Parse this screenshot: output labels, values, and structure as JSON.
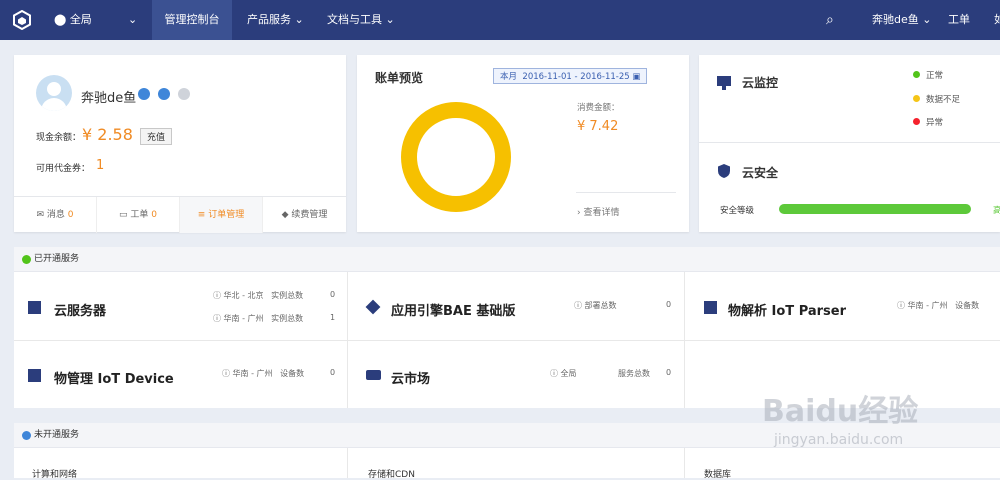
{
  "topbar": {
    "region": "全局",
    "nav": [
      "管理控制台",
      "产品服务",
      "文档与工具"
    ],
    "user": "奔驰de鱼",
    "ticket": "工单",
    "more": "如"
  },
  "account": {
    "name": "奔驰de鱼",
    "cash_label": "现金余额：",
    "cash_value": "¥ 2.58",
    "recharge": "充值",
    "voucher_label": "可用代金券：",
    "voucher_value": "1",
    "tabs": [
      {
        "label": "消息",
        "count": "0"
      },
      {
        "label": "工单",
        "count": "0"
      },
      {
        "label": "订单管理",
        "count": ""
      },
      {
        "label": "续费管理",
        "count": ""
      }
    ]
  },
  "bill": {
    "title": "账单预览",
    "range_label": "本月",
    "range": "2016-11-01 - 2016-11-25",
    "consume_label": "消费金额：",
    "consume_value": "¥ 7.42",
    "detail": "查看详情",
    "ring_color": "#f6c000"
  },
  "monitor": {
    "title": "云监控",
    "legend": [
      {
        "label": "正常",
        "color": "#52c41a"
      },
      {
        "label": "数据不足",
        "color": "#f5c518"
      },
      {
        "label": "异常",
        "color": "#f5222d"
      }
    ]
  },
  "security": {
    "title": "云安全",
    "level_label": "安全等级",
    "level_value": 1.0,
    "level_text": "高",
    "bar_color": "#5dc93a"
  },
  "opened": {
    "header": "已开通服务",
    "services": [
      {
        "name": "云服务器",
        "rows": [
          {
            "region": "华北 - 北京",
            "metric": "实例总数",
            "count": "0"
          },
          {
            "region": "华南 - 广州",
            "metric": "实例总数",
            "count": "1"
          }
        ]
      },
      {
        "name": "应用引擎BAE 基础版",
        "rows": [
          {
            "region": "",
            "metric": "部署总数",
            "count": "0"
          }
        ]
      },
      {
        "name": "物解析 IoT Parser",
        "rows": [
          {
            "region": "华南 - 广州",
            "metric": "设备数",
            "count": ""
          }
        ]
      },
      {
        "name": "物管理 IoT Device",
        "rows": [
          {
            "region": "华南 - 广州",
            "metric": "设备数",
            "count": "0"
          }
        ]
      },
      {
        "name": "云市场",
        "rows": [
          {
            "region": "全局",
            "metric": "服务总数",
            "count": "0"
          }
        ]
      }
    ]
  },
  "unopened": {
    "header": "未开通服务",
    "categories": [
      "计算和网络",
      "存储和CDN",
      "数据库"
    ]
  },
  "watermark": {
    "brand": "Baidu经验",
    "url": "jingyan.baidu.com"
  }
}
